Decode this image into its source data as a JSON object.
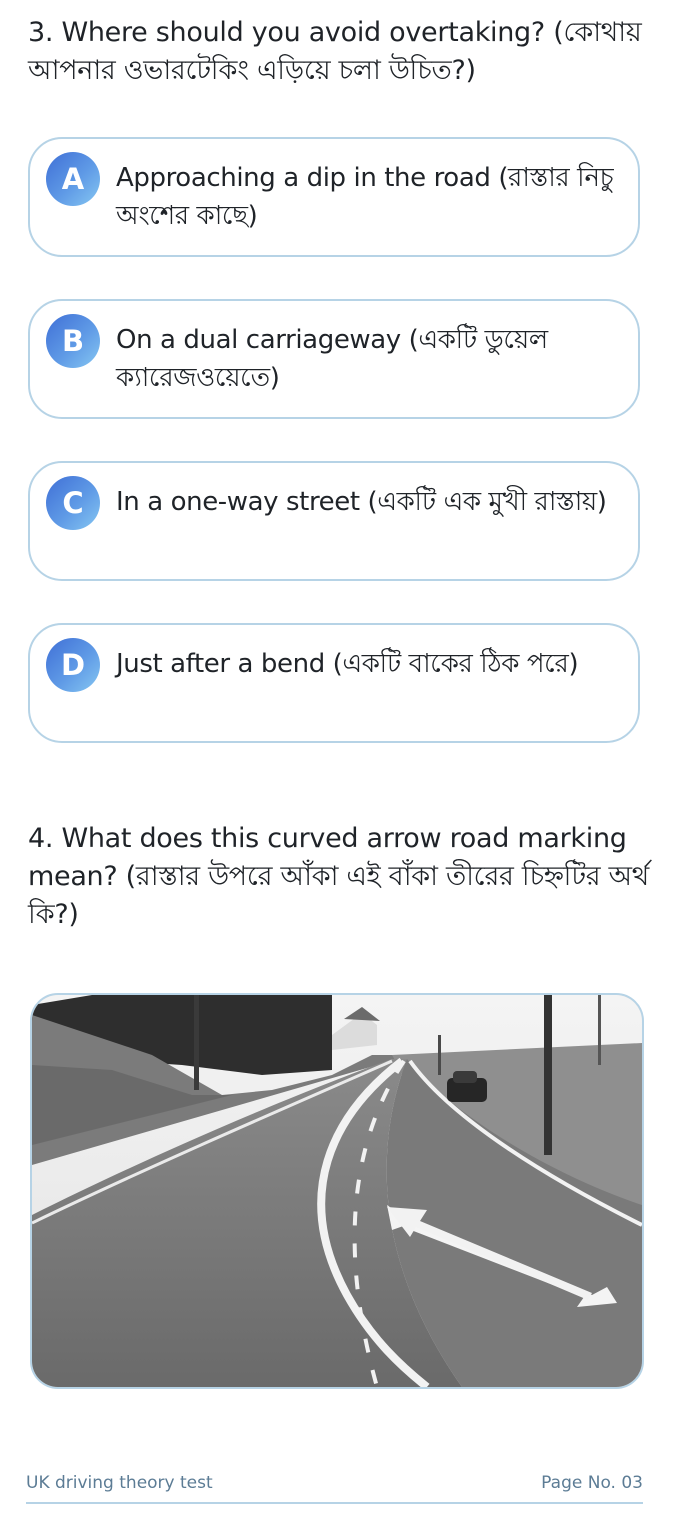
{
  "questions": [
    {
      "text": "3. Where should you avoid overtaking? (কোথায় আপনার ওভারটেকিং এড়িয়ে চলা উচিত?)",
      "options": [
        {
          "letter": "A",
          "text": "Approaching a dip in the road (রাস্তার নিচু অংশের কাছে)"
        },
        {
          "letter": "B",
          "text": "On a dual carriageway (একটি ডুয়েল ক্যারেজওয়েতে)"
        },
        {
          "letter": "C",
          "text": "In a one-way street (একটি এক মুখী রাস্তায়)"
        },
        {
          "letter": "D",
          "text": "Just after a bend (একটি বাকের ঠিক পরে)"
        }
      ]
    },
    {
      "text": "4. What does this curved arrow road marking mean? (রাস্তার উপরে আঁকা এই বাঁকা তীরের চিহ্নটির অর্থ কি?)"
    }
  ],
  "image": {
    "subject": "road-photo-curved-arrow-marking"
  },
  "footer": {
    "left": "UK driving theory test",
    "right": "Page No. 03"
  },
  "colors": {
    "border": "#b6d3e6",
    "badge_start": "#3f6fd6",
    "badge_end": "#86c7f2",
    "footer_text": "#5c7c95",
    "body_text": "#1f2328"
  }
}
